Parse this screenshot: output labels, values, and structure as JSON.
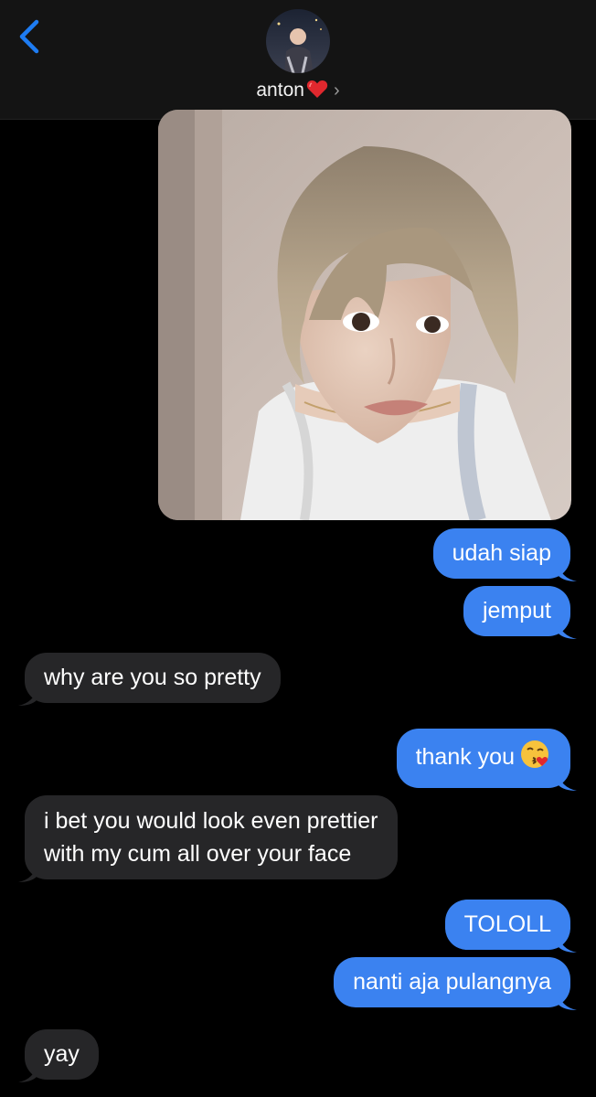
{
  "header": {
    "back_icon": "chevron-left-icon",
    "contact_name": "anton",
    "contact_emoji": "heart-icon",
    "disclosure_icon": "chevron-right-icon"
  },
  "colors": {
    "outgoing_bubble": "#3b82f0",
    "incoming_bubble": "#262628",
    "accent": "#1e7cf2",
    "background": "#000000"
  },
  "messages": [
    {
      "from": "me",
      "type": "photo",
      "text": ""
    },
    {
      "from": "me",
      "type": "text",
      "text": "udah siap"
    },
    {
      "from": "me",
      "type": "text",
      "text": "jemput"
    },
    {
      "from": "them",
      "type": "text",
      "text": "why are you so pretty"
    },
    {
      "from": "me",
      "type": "text",
      "text": "thank you",
      "emoji": "face-blowing-kiss"
    },
    {
      "from": "them",
      "type": "text",
      "text": "i bet you would look even prettier",
      "text_line2": "with my cum all over your face"
    },
    {
      "from": "me",
      "type": "text",
      "text": "TOLOLL"
    },
    {
      "from": "me",
      "type": "text",
      "text": "nanti aja pulangnya"
    },
    {
      "from": "them",
      "type": "text",
      "text": "yay"
    }
  ]
}
